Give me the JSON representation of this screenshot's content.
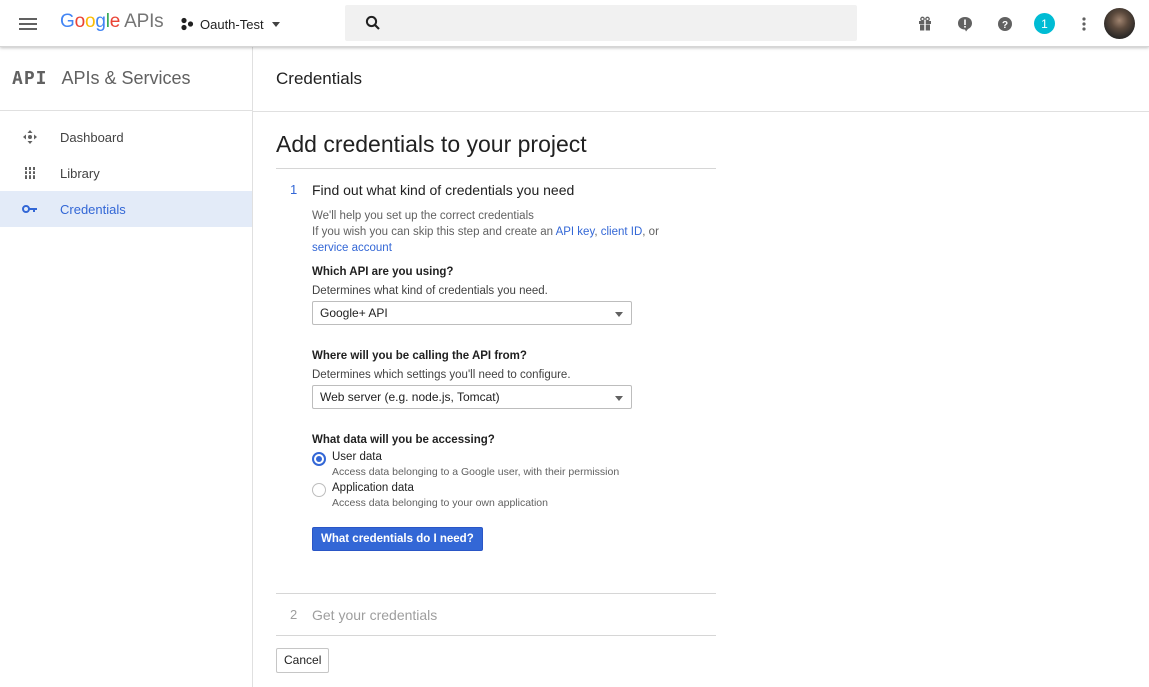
{
  "topbar": {
    "logo": {
      "brand": "Google",
      "product": "APIs"
    },
    "project_name": "Oauth-Test",
    "search_placeholder": "",
    "notification_count": "1"
  },
  "sidebar": {
    "badge": "API",
    "title": "APIs & Services",
    "items": [
      {
        "label": "Dashboard",
        "icon": "dashboard-icon"
      },
      {
        "label": "Library",
        "icon": "library-icon"
      },
      {
        "label": "Credentials",
        "icon": "key-icon",
        "active": true
      }
    ]
  },
  "main": {
    "page_title": "Credentials",
    "heading": "Add credentials to your project",
    "step1": {
      "number": "1",
      "title": "Find out what kind of credentials you need",
      "help_line1": "We'll help you set up the correct credentials",
      "help_line2_prefix": "If you wish you can skip this step and create an ",
      "link_api_key": "API key",
      "comma": ",",
      "link_client_id": "client ID",
      "help_or": ", or",
      "link_service_account": "service account",
      "q1_label": "Which API are you using?",
      "q1_desc": "Determines what kind of credentials you need.",
      "q1_value": "Google+ API",
      "q2_label": "Where will you be calling the API from?",
      "q2_desc": "Determines which settings you'll need to configure.",
      "q2_value": "Web server (e.g. node.js, Tomcat)",
      "q3_label": "What data will you be accessing?",
      "options": [
        {
          "label": "User data",
          "desc": "Access data belonging to a Google user, with their permission",
          "checked": true
        },
        {
          "label": "Application data",
          "desc": "Access data belonging to your own application",
          "checked": false
        }
      ],
      "submit_label": "What credentials do I need?"
    },
    "step2": {
      "number": "2",
      "title": "Get your credentials"
    },
    "cancel_label": "Cancel"
  },
  "colors": {
    "accent": "#3367d6",
    "badge": "#00bcd4"
  }
}
